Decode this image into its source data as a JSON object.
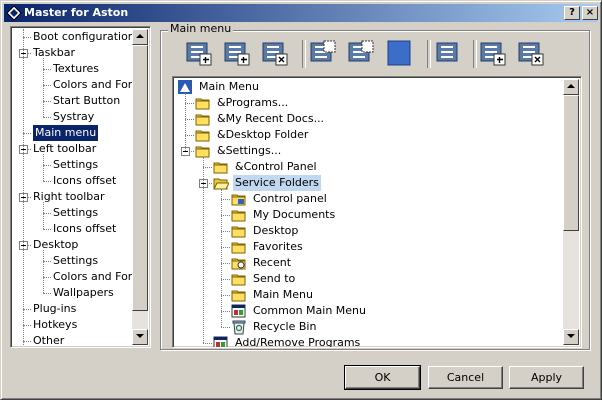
{
  "window": {
    "title": "Master for Aston",
    "help_label": "?",
    "close_label": "×"
  },
  "left_tree": [
    {
      "label": "Boot configuration",
      "level": 0,
      "expander": false,
      "selected": false
    },
    {
      "label": "Taskbar",
      "level": 0,
      "expander": true,
      "selected": false
    },
    {
      "label": "Textures",
      "level": 1,
      "expander": false,
      "selected": false
    },
    {
      "label": "Colors and Fonts",
      "level": 1,
      "expander": false,
      "selected": false
    },
    {
      "label": "Start Button",
      "level": 1,
      "expander": false,
      "selected": false
    },
    {
      "label": "Systray",
      "level": 1,
      "expander": false,
      "selected": false
    },
    {
      "label": "Main menu",
      "level": 0,
      "expander": false,
      "selected": true
    },
    {
      "label": "Left toolbar",
      "level": 0,
      "expander": true,
      "selected": false
    },
    {
      "label": "Settings",
      "level": 1,
      "expander": false,
      "selected": false
    },
    {
      "label": "Icons offset",
      "level": 1,
      "expander": false,
      "selected": false
    },
    {
      "label": "Right toolbar",
      "level": 0,
      "expander": true,
      "selected": false
    },
    {
      "label": "Settings",
      "level": 1,
      "expander": false,
      "selected": false
    },
    {
      "label": "Icons offset",
      "level": 1,
      "expander": false,
      "selected": false
    },
    {
      "label": "Desktop",
      "level": 0,
      "expander": true,
      "selected": false
    },
    {
      "label": "Settings",
      "level": 1,
      "expander": false,
      "selected": false
    },
    {
      "label": "Colors and Fonts",
      "level": 1,
      "expander": false,
      "selected": false
    },
    {
      "label": "Wallpapers",
      "level": 1,
      "expander": false,
      "selected": false
    },
    {
      "label": "Plug-ins",
      "level": 0,
      "expander": false,
      "selected": false
    },
    {
      "label": "Hotkeys",
      "level": 0,
      "expander": false,
      "selected": false
    },
    {
      "label": "Other",
      "level": 0,
      "expander": false,
      "selected": false
    }
  ],
  "group": {
    "label": "Main menu"
  },
  "toolbar": [
    {
      "name": "add-item-button",
      "icon": "list-add-icon"
    },
    {
      "name": "add-submenu-button",
      "icon": "list-add-sub-icon"
    },
    {
      "name": "delete-item-button",
      "icon": "list-delete-icon"
    },
    {
      "name": "move-item-button",
      "icon": "list-move-icon"
    },
    {
      "name": "copy-item-button",
      "icon": "list-copy-icon"
    },
    {
      "name": "properties-button",
      "icon": "blue-square-icon"
    },
    {
      "name": "view-list-button",
      "icon": "list-view-icon"
    },
    {
      "name": "add-page-button",
      "icon": "list-page-add-icon"
    },
    {
      "name": "remove-page-button",
      "icon": "list-page-delete-icon"
    }
  ],
  "menu_tree": [
    {
      "label": "Main Menu",
      "level": 0,
      "icon": "main-menu-icon",
      "expander": false,
      "selected": false
    },
    {
      "label": "&Programs...",
      "level": 1,
      "icon": "folder-icon",
      "expander": false,
      "selected": false
    },
    {
      "label": "&My Recent Docs...",
      "level": 1,
      "icon": "folder-icon",
      "expander": false,
      "selected": false
    },
    {
      "label": "&Desktop Folder",
      "level": 1,
      "icon": "folder-icon",
      "expander": false,
      "selected": false
    },
    {
      "label": "&Settings...",
      "level": 1,
      "icon": "folder-icon",
      "expander": true,
      "selected": false
    },
    {
      "label": "&Control Panel",
      "level": 2,
      "icon": "folder-icon",
      "expander": false,
      "selected": false
    },
    {
      "label": "Service Folders",
      "level": 2,
      "icon": "open-folder-icon",
      "expander": true,
      "selected": true
    },
    {
      "label": "Control panel",
      "level": 3,
      "icon": "control-panel-icon",
      "expander": false,
      "selected": false
    },
    {
      "label": "My Documents",
      "level": 3,
      "icon": "folder-icon",
      "expander": false,
      "selected": false
    },
    {
      "label": "Desktop",
      "level": 3,
      "icon": "folder-icon",
      "expander": false,
      "selected": false
    },
    {
      "label": "Favorites",
      "level": 3,
      "icon": "folder-icon",
      "expander": false,
      "selected": false
    },
    {
      "label": "Recent",
      "level": 3,
      "icon": "recent-folder-icon",
      "expander": false,
      "selected": false
    },
    {
      "label": "Send to",
      "level": 3,
      "icon": "folder-icon",
      "expander": false,
      "selected": false
    },
    {
      "label": "Main Menu",
      "level": 3,
      "icon": "folder-icon",
      "expander": false,
      "selected": false
    },
    {
      "label": "Common Main Menu",
      "level": 3,
      "icon": "common-menu-icon",
      "expander": false,
      "selected": false
    },
    {
      "label": "Recycle Bin",
      "level": 3,
      "icon": "recycle-bin-icon",
      "expander": false,
      "selected": false
    },
    {
      "label": "Add/Remove Programs",
      "level": 2,
      "icon": "add-remove-icon",
      "expander": false,
      "selected": false
    }
  ],
  "buttons": {
    "ok": "OK",
    "cancel": "Cancel",
    "apply": "Apply"
  }
}
